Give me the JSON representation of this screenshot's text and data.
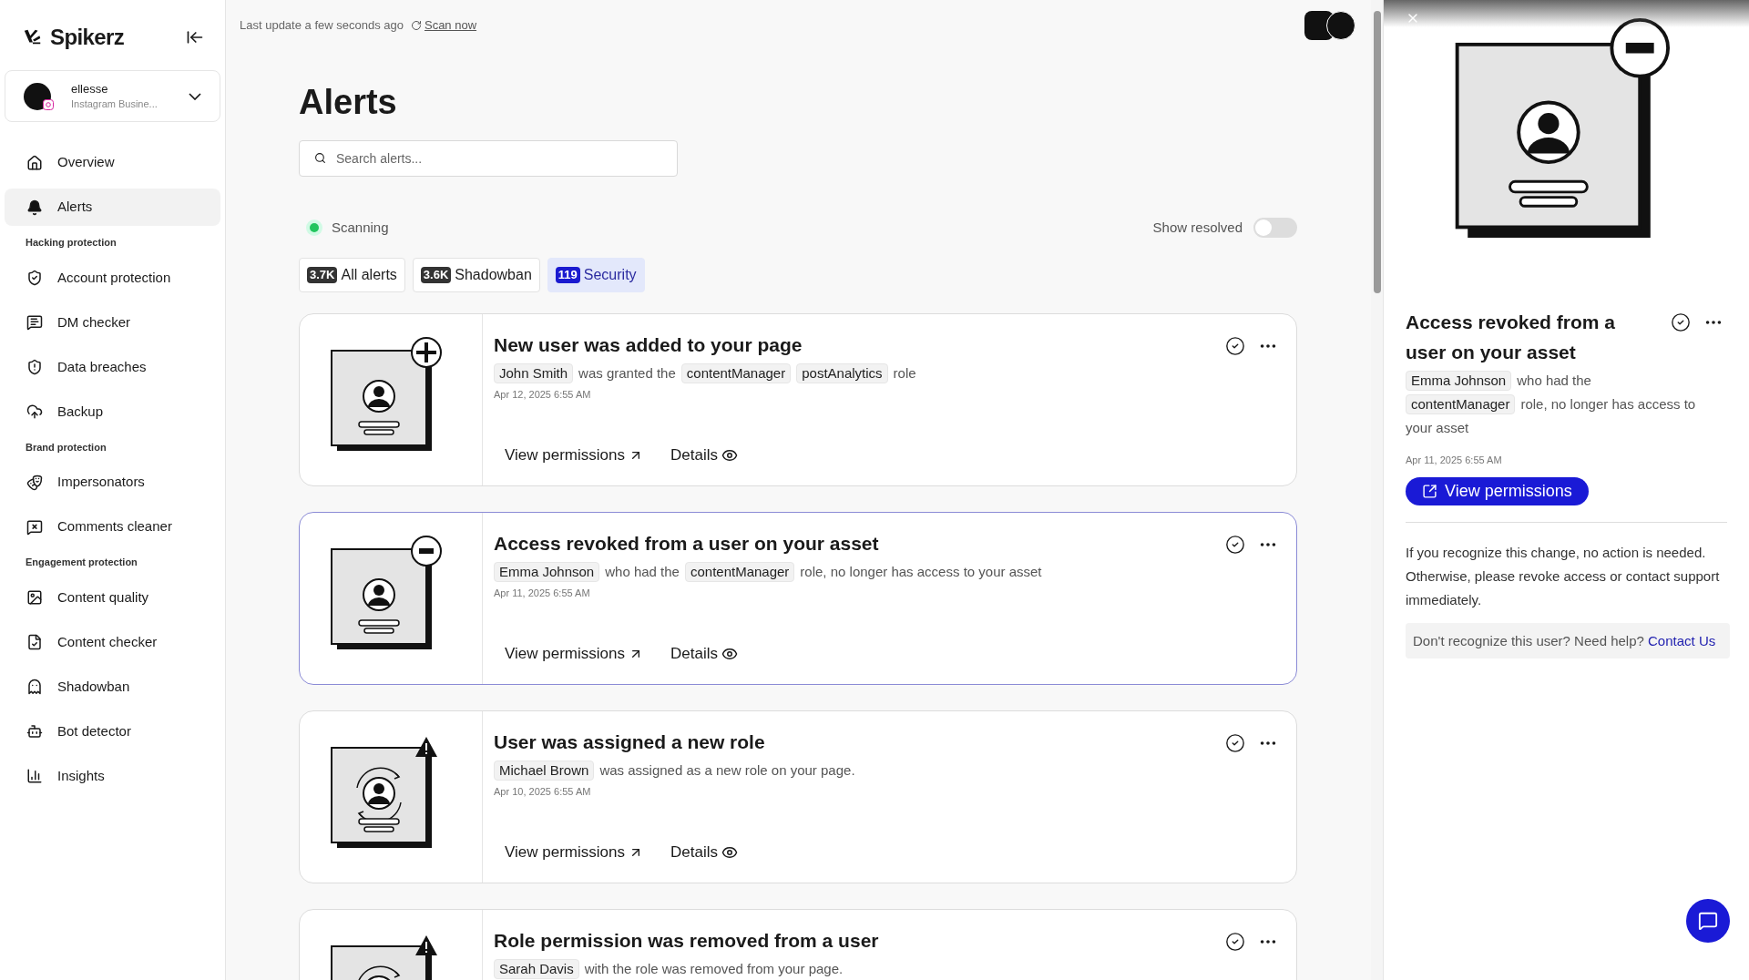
{
  "brand": {
    "name": "Spikerz"
  },
  "account": {
    "name": "ellesse",
    "type": "Instagram Busine..."
  },
  "sidebar": {
    "sections": [
      {
        "items": [
          {
            "label": "Overview",
            "selected": false
          },
          {
            "label": "Alerts",
            "selected": true
          }
        ]
      },
      {
        "heading": "Hacking protection",
        "items": [
          {
            "label": "Account protection",
            "selected": false
          },
          {
            "label": "DM checker",
            "selected": false
          },
          {
            "label": "Data breaches",
            "selected": false
          },
          {
            "label": "Backup",
            "selected": false
          }
        ]
      },
      {
        "heading": "Brand protection",
        "items": [
          {
            "label": "Impersonators",
            "selected": false
          },
          {
            "label": "Comments cleaner",
            "selected": false
          }
        ]
      },
      {
        "heading": "Engagement protection",
        "items": [
          {
            "label": "Content quality",
            "selected": false
          },
          {
            "label": "Content checker",
            "selected": false
          },
          {
            "label": "Shadowban",
            "selected": false
          },
          {
            "label": "Bot detector",
            "selected": false
          },
          {
            "label": "Insights",
            "selected": false
          }
        ]
      }
    ]
  },
  "header": {
    "last_update": "Last update a few seconds ago",
    "scan_link": "Scan now"
  },
  "page_title": "Alerts",
  "search": {
    "placeholder": "Search alerts..."
  },
  "status": {
    "label": "Scanning",
    "color": "#22c55e"
  },
  "show_resolved": {
    "label": "Show resolved",
    "on": false
  },
  "tabs": [
    {
      "count": "3.7K",
      "label": "All alerts",
      "selected": false
    },
    {
      "count": "3.6K",
      "label": "Shadowban",
      "selected": false
    },
    {
      "count": "119",
      "label": "Security",
      "selected": true
    }
  ],
  "alerts": [
    {
      "kind": "plus",
      "selected": false,
      "title": "New user was added to your page",
      "description": [
        {
          "kind": "chip",
          "text": "John Smith"
        },
        {
          "kind": "text",
          "text": "was granted the"
        },
        {
          "kind": "chip",
          "text": "contentManager"
        },
        {
          "kind": "chip",
          "text": "postAnalytics"
        },
        {
          "kind": "text",
          "text": "role"
        }
      ],
      "date": "Apr 12, 2025 6:55 AM",
      "actions": [
        "View permissions",
        "Details"
      ]
    },
    {
      "kind": "minus",
      "selected": true,
      "title": "Access revoked from a user on your asset",
      "description": [
        {
          "kind": "chip",
          "text": "Emma Johnson"
        },
        {
          "kind": "text",
          "text": "who had the"
        },
        {
          "kind": "chip",
          "text": "contentManager"
        },
        {
          "kind": "text",
          "text": "role, no longer has access to your asset"
        }
      ],
      "date": "Apr 11, 2025 6:55 AM",
      "actions": [
        "View permissions",
        "Details"
      ]
    },
    {
      "kind": "warning",
      "selected": false,
      "title": "User was assigned a new role",
      "description": [
        {
          "kind": "chip",
          "text": "Michael Brown"
        },
        {
          "kind": "text",
          "text": "was assigned as a new role on your page."
        }
      ],
      "date": "Apr 10, 2025 6:55 AM",
      "actions": [
        "View permissions",
        "Details"
      ]
    },
    {
      "kind": "warning",
      "selected": false,
      "title": "Role permission was removed from a user",
      "description": [
        {
          "kind": "chip",
          "text": "Sarah Davis"
        },
        {
          "kind": "text",
          "text": "with the role was removed from your page."
        }
      ]
    }
  ],
  "detail_panel": {
    "kind": "minus",
    "title": "Access revoked from a user on your asset",
    "description": [
      {
        "kind": "chip",
        "text": "Emma Johnson"
      },
      {
        "kind": "text",
        "text": "who had the"
      },
      {
        "kind": "chip",
        "text": "contentManager"
      },
      {
        "kind": "text",
        "text": "role, no longer has access to your asset"
      }
    ],
    "date": "Apr 11, 2025 6:55 AM",
    "button": "View permissions",
    "advice": "If you recognize this change, no action is needed. Otherwise, please revoke access or contact support immediately.",
    "help_text": "Don't recognize this user? Need help?",
    "help_link": "Contact Us"
  }
}
